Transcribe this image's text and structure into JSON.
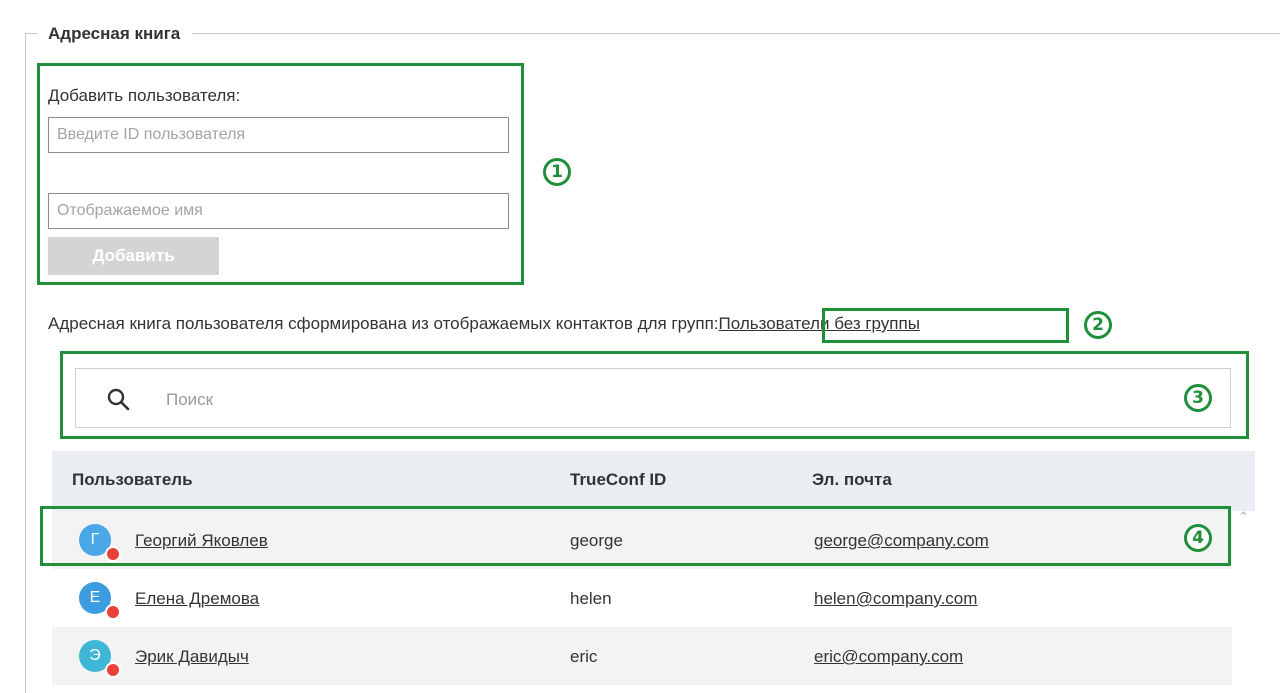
{
  "section": {
    "legend": "Адресная книга"
  },
  "add_user": {
    "label": "Добавить пользователя:",
    "id_placeholder": "Введите ID пользователя",
    "name_placeholder": "Отображаемое имя",
    "button_label": "Добавить"
  },
  "info": {
    "text": "Адресная книга пользователя сформирована из отображаемых контактов для групп:",
    "group_link": "Пользователи без группы"
  },
  "search": {
    "placeholder": "Поиск"
  },
  "table": {
    "headers": {
      "user": "Пользователь",
      "id": "TrueConf ID",
      "email": "Эл. почта"
    },
    "rows": [
      {
        "initial": "Г",
        "name": "Георгий Яковлев",
        "id": "george",
        "email": "george@company.com",
        "avatar_color": "#4aa8e8"
      },
      {
        "initial": "Е",
        "name": "Елена Дремова",
        "id": "helen",
        "email": "helen@company.com",
        "avatar_color": "#3d9be0"
      },
      {
        "initial": "Э",
        "name": "Эрик Давидыч",
        "id": "eric",
        "email": "eric@company.com",
        "avatar_color": "#3fb6d6"
      }
    ]
  },
  "annotations": {
    "n1": "1",
    "n2": "2",
    "n3": "3",
    "n4": "4"
  },
  "colors": {
    "annotation": "#1f8f3a",
    "status_offline": "#e8413a",
    "table_header_bg": "#eaeef2"
  },
  "icons": {
    "search": "search-icon",
    "scroll_up": "chevron-up-icon"
  }
}
